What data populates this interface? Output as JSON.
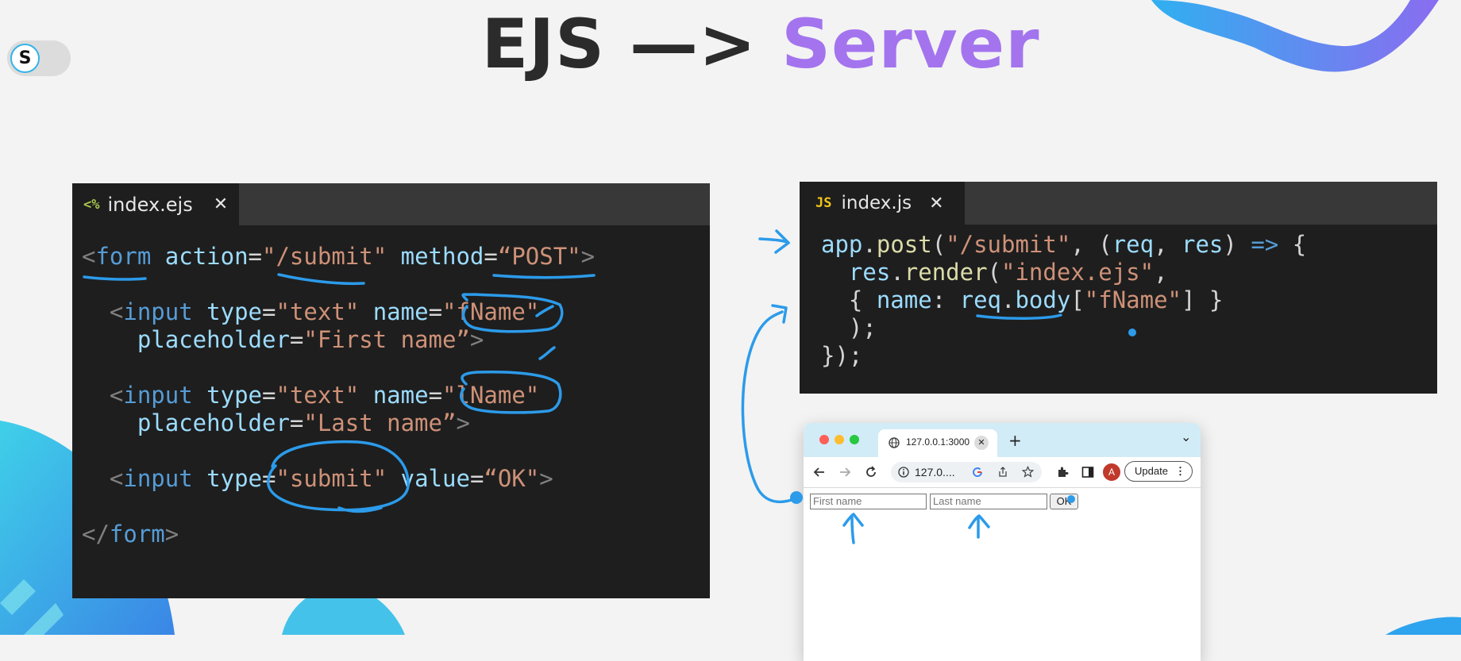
{
  "slide": {
    "title_left": "EJS —> ",
    "title_right": "Server",
    "accent_color": "#a374ee",
    "logo_letter": "S"
  },
  "ejs_editor": {
    "tab_icon": "<%",
    "tab_name": "index.ejs",
    "close_icon": "✕",
    "lines": [
      [
        [
          "t",
          "<"
        ],
        [
          "k",
          "form"
        ],
        [
          "p",
          " "
        ],
        [
          "a",
          "action"
        ],
        [
          "p",
          "="
        ],
        [
          "s",
          "\"/submit\""
        ],
        [
          "p",
          " "
        ],
        [
          "a",
          "method"
        ],
        [
          "p",
          "="
        ],
        [
          "s",
          "“POST\""
        ],
        [
          "t",
          ">"
        ]
      ],
      [],
      [
        [
          "p",
          "  "
        ],
        [
          "t",
          "<"
        ],
        [
          "k",
          "input"
        ],
        [
          "p",
          " "
        ],
        [
          "a",
          "type"
        ],
        [
          "p",
          "="
        ],
        [
          "s",
          "\"text\""
        ],
        [
          "p",
          " "
        ],
        [
          "a",
          "name"
        ],
        [
          "p",
          "="
        ],
        [
          "s",
          "\"fName\""
        ]
      ],
      [
        [
          "p",
          "    "
        ],
        [
          "a",
          "placeholder"
        ],
        [
          "p",
          "="
        ],
        [
          "s",
          "\"First name”"
        ],
        [
          "t",
          ">"
        ]
      ],
      [],
      [
        [
          "p",
          "  "
        ],
        [
          "t",
          "<"
        ],
        [
          "k",
          "input"
        ],
        [
          "p",
          " "
        ],
        [
          "a",
          "type"
        ],
        [
          "p",
          "="
        ],
        [
          "s",
          "\"text\""
        ],
        [
          "p",
          " "
        ],
        [
          "a",
          "name"
        ],
        [
          "p",
          "="
        ],
        [
          "s",
          "\"lName\""
        ]
      ],
      [
        [
          "p",
          "    "
        ],
        [
          "a",
          "placeholder"
        ],
        [
          "p",
          "="
        ],
        [
          "s",
          "\"Last name”"
        ],
        [
          "t",
          ">"
        ]
      ],
      [],
      [
        [
          "p",
          "  "
        ],
        [
          "t",
          "<"
        ],
        [
          "k",
          "input"
        ],
        [
          "p",
          " "
        ],
        [
          "a",
          "type"
        ],
        [
          "p",
          "="
        ],
        [
          "s",
          "\"submit\""
        ],
        [
          "p",
          " "
        ],
        [
          "a",
          "value"
        ],
        [
          "p",
          "="
        ],
        [
          "s",
          "“OK\""
        ],
        [
          "t",
          ">"
        ]
      ],
      [],
      [
        [
          "t",
          "</"
        ],
        [
          "k",
          "form"
        ],
        [
          "t",
          ">"
        ]
      ]
    ]
  },
  "js_editor": {
    "tab_icon": "JS",
    "tab_name": "index.js",
    "close_icon": "✕",
    "lines": [
      [
        [
          "a",
          "app"
        ],
        [
          "p",
          "."
        ],
        [
          "f",
          "post"
        ],
        [
          "p",
          "("
        ],
        [
          "s",
          "\"/submit\""
        ],
        [
          "p",
          ", ("
        ],
        [
          "a",
          "req"
        ],
        [
          "p",
          ", "
        ],
        [
          "a",
          "res"
        ],
        [
          "p",
          ") "
        ],
        [
          "k",
          "=>"
        ],
        [
          "p",
          " {"
        ]
      ],
      [
        [
          "p",
          "  "
        ],
        [
          "a",
          "res"
        ],
        [
          "p",
          "."
        ],
        [
          "f",
          "render"
        ],
        [
          "p",
          "("
        ],
        [
          "s",
          "\"index.ejs\""
        ],
        [
          "p",
          ","
        ]
      ],
      [
        [
          "p",
          "  { "
        ],
        [
          "a",
          "name"
        ],
        [
          "p",
          ": "
        ],
        [
          "a",
          "req"
        ],
        [
          "p",
          "."
        ],
        [
          "a",
          "body"
        ],
        [
          "p",
          "["
        ],
        [
          "s",
          "\"fName\""
        ],
        [
          "p",
          "] }"
        ]
      ],
      [
        [
          "p",
          "  );"
        ]
      ],
      [
        [
          "p",
          "});"
        ]
      ]
    ]
  },
  "browser": {
    "tab_title": "127.0.0.1:3000",
    "tab_close": "✕",
    "new_tab": "+",
    "tab_menu": "⌄",
    "url": "127.0....",
    "profile_initial": "A",
    "update_label": "Update",
    "first_name_placeholder": "First name",
    "last_name_placeholder": "Last name",
    "submit_label": "OK",
    "traffic_light_colors": [
      "#fe5f57",
      "#febc2e",
      "#28c840"
    ]
  },
  "colors": {
    "ink": "#2c9bea",
    "editor_bg": "#1e1e1e",
    "tabbar_bg": "#383838"
  }
}
